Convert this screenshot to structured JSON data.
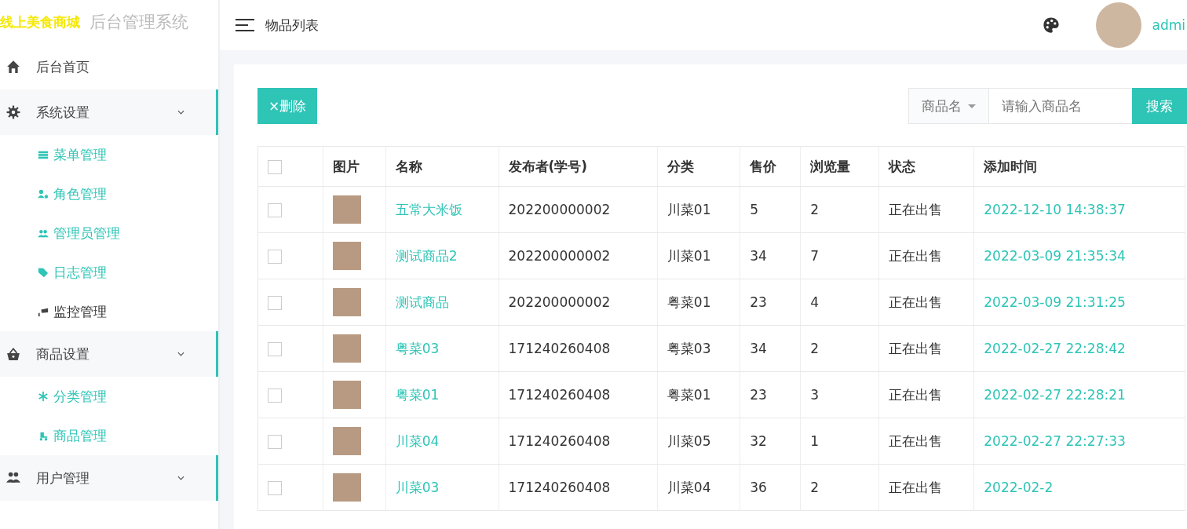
{
  "logo": {
    "title": "线上美食商城",
    "subtitle": "后台管理系统"
  },
  "header": {
    "page_title": "物品列表",
    "user": "admi"
  },
  "sidebar": {
    "items": [
      {
        "label": "后台首页",
        "kind": "link"
      },
      {
        "label": "系统设置",
        "kind": "group",
        "children": [
          {
            "label": "菜单管理",
            "active": true
          },
          {
            "label": "角色管理",
            "active": true
          },
          {
            "label": "管理员管理",
            "active": true
          },
          {
            "label": "日志管理",
            "active": true
          },
          {
            "label": "监控管理",
            "active": false
          }
        ]
      },
      {
        "label": "商品设置",
        "kind": "group",
        "children": [
          {
            "label": "分类管理",
            "active": true
          },
          {
            "label": "商品管理",
            "active": true
          }
        ]
      },
      {
        "label": "用户管理",
        "kind": "group"
      }
    ]
  },
  "toolbar": {
    "delete_button": "×删除",
    "search_field": {
      "label": "商品名",
      "placeholder": "请输入商品名"
    },
    "search_button": "搜索"
  },
  "table": {
    "header_checked": false,
    "columns": [
      "图片",
      "名称",
      "发布者(学号)",
      "分类",
      "售价",
      "浏览量",
      "状态",
      "添加时间"
    ],
    "rows": [
      {
        "checked": false,
        "name": "五常大米饭",
        "publisher": "202200000002",
        "category": "川菜01",
        "price": "5",
        "views": "2",
        "status": "正在出售",
        "added": "2022-12-10 14:38:37"
      },
      {
        "checked": false,
        "name": "测试商品2",
        "publisher": "202200000002",
        "category": "川菜01",
        "price": "34",
        "views": "7",
        "status": "正在出售",
        "added": "2022-03-09 21:35:34"
      },
      {
        "checked": false,
        "name": "测试商品",
        "publisher": "202200000002",
        "category": "粤菜01",
        "price": "23",
        "views": "4",
        "status": "正在出售",
        "added": "2022-03-09 21:31:25"
      },
      {
        "checked": false,
        "name": "粤菜03",
        "publisher": "171240260408",
        "category": "粤菜03",
        "price": "34",
        "views": "2",
        "status": "正在出售",
        "added": "2022-02-27 22:28:42"
      },
      {
        "checked": false,
        "name": "粤菜01",
        "publisher": "171240260408",
        "category": "粤菜01",
        "price": "23",
        "views": "3",
        "status": "正在出售",
        "added": "2022-02-27 22:28:21"
      },
      {
        "checked": false,
        "name": "川菜04",
        "publisher": "171240260408",
        "category": "川菜05",
        "price": "32",
        "views": "1",
        "status": "正在出售",
        "added": "2022-02-27 22:27:33"
      },
      {
        "checked": false,
        "name": "川菜03",
        "publisher": "171240260408",
        "category": "川菜04",
        "price": "36",
        "views": "2",
        "status": "正在出售",
        "added": "2022-02-2"
      }
    ]
  }
}
